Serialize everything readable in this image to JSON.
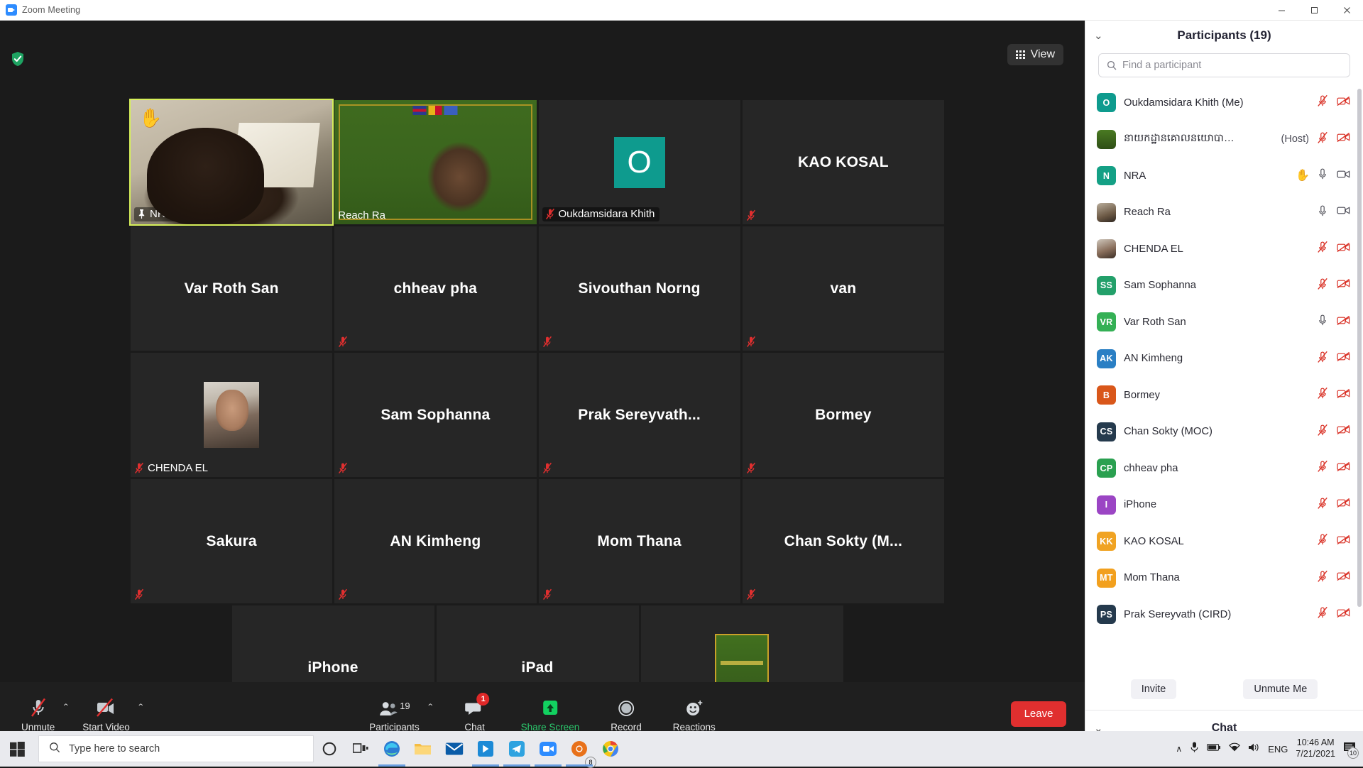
{
  "window": {
    "title": "Zoom Meeting",
    "app_icon": "zoom-icon",
    "minimize": "—",
    "maximize": "☐",
    "close": "✕"
  },
  "meeting": {
    "view_button": "View",
    "view_icon": "grid-icon",
    "security_icon": "shield-check-icon",
    "tiles": [
      [
        {
          "name": "NRA",
          "display": "corner",
          "video": true,
          "muted": false,
          "pinned": true,
          "active_speaker": true,
          "hand_raised": true,
          "photo": "nra"
        },
        {
          "name": "Reach Ra",
          "display": "corner",
          "video": true,
          "muted": false,
          "pinned": false,
          "active_speaker": false,
          "hand_raised": false,
          "photo": "reach"
        },
        {
          "name": "Oukdamsidara Khith",
          "display": "corner",
          "video": false,
          "muted": true,
          "avatar_initial": "O",
          "avatar_color": "#0e9b8e"
        },
        {
          "name": "KAO KOSAL",
          "display": "center",
          "video": false,
          "muted": true
        }
      ],
      [
        {
          "name": "Var Roth San",
          "display": "center",
          "video": false,
          "muted": false
        },
        {
          "name": "chheav pha",
          "display": "center",
          "video": false,
          "muted": true
        },
        {
          "name": "Sivouthan Norng",
          "display": "center",
          "video": false,
          "muted": true
        },
        {
          "name": "van",
          "display": "center",
          "video": false,
          "muted": true
        }
      ],
      [
        {
          "name": "CHENDA EL",
          "display": "corner",
          "video": false,
          "muted": true,
          "photo": "chenda"
        },
        {
          "name": "Sam Sophanna",
          "display": "center",
          "video": false,
          "muted": true
        },
        {
          "name": "Prak  Sereyvath...",
          "display": "center",
          "video": false,
          "muted": true
        },
        {
          "name": "Bormey",
          "display": "center",
          "video": false,
          "muted": true
        }
      ],
      [
        {
          "name": "Sakura",
          "display": "center",
          "video": false,
          "muted": true
        },
        {
          "name": "AN Kimheng",
          "display": "center",
          "video": false,
          "muted": true
        },
        {
          "name": "Mom Thana",
          "display": "center",
          "video": false,
          "muted": true
        },
        {
          "name": "Chan Sokty (M...",
          "display": "center",
          "video": false,
          "muted": true
        }
      ],
      [
        {
          "name": "iPhone",
          "display": "center",
          "video": false,
          "muted": true
        },
        {
          "name": "iPad",
          "display": "center",
          "video": false,
          "muted": false
        },
        {
          "name": "នាយកដ្ឋានគោលនយោ...",
          "display": "corner",
          "video": false,
          "muted": true,
          "photo": "khmer"
        }
      ]
    ]
  },
  "toolbar": {
    "mute": {
      "label": "Unmute",
      "icon": "mic-off-icon",
      "caret": "⌃"
    },
    "video": {
      "label": "Start Video",
      "icon": "video-off-icon",
      "caret": "⌃"
    },
    "participants": {
      "label": "Participants",
      "icon": "participants-icon",
      "count": "19",
      "caret": "⌃"
    },
    "chat": {
      "label": "Chat",
      "icon": "chat-icon",
      "badge": "1"
    },
    "share": {
      "label": "Share Screen",
      "icon": "share-screen-icon"
    },
    "record": {
      "label": "Record",
      "icon": "record-icon"
    },
    "reactions": {
      "label": "Reactions",
      "icon": "reactions-icon"
    },
    "leave": {
      "label": "Leave"
    }
  },
  "panel": {
    "title": "Participants (19)",
    "collapse_icon": "chevron-down-icon",
    "search": {
      "placeholder": "Find a participant",
      "value": "",
      "icon": "search-icon"
    },
    "participants": [
      {
        "name": "Oukdamsidara Khith (Me)",
        "initials": "O",
        "color": "#0e9b8e",
        "mic": "muted",
        "video": "off",
        "host": false,
        "hand": false
      },
      {
        "name": "នាយកដ្ឋានគោលនយោបា…",
        "initials": "",
        "color": "#4a7a22",
        "mic": "muted",
        "video": "off",
        "host": true,
        "host_label": "(Host)",
        "hand": false,
        "avatar_type": "image-khmer"
      },
      {
        "name": "NRA",
        "initials": "N",
        "color": "#14a085",
        "mic": "unmuted",
        "video": "on",
        "host": false,
        "hand": true
      },
      {
        "name": "Reach Ra",
        "initials": "",
        "color": "#8a7158",
        "mic": "unmuted",
        "video": "on",
        "host": false,
        "hand": false,
        "avatar_type": "photo1"
      },
      {
        "name": "CHENDA EL",
        "initials": "",
        "color": "#8a7158",
        "mic": "muted",
        "video": "off",
        "host": false,
        "hand": false,
        "avatar_type": "photo2"
      },
      {
        "name": "Sam Sophanna",
        "initials": "SS",
        "color": "#23a06a",
        "mic": "muted",
        "video": "off",
        "host": false,
        "hand": false
      },
      {
        "name": "Var Roth San",
        "initials": "VR",
        "color": "#34b055",
        "mic": "unmuted",
        "video": "off",
        "host": false,
        "hand": false
      },
      {
        "name": "AN Kimheng",
        "initials": "AK",
        "color": "#2a7fc4",
        "mic": "muted",
        "video": "off",
        "host": false,
        "hand": false
      },
      {
        "name": "Bormey",
        "initials": "B",
        "color": "#d9571a",
        "mic": "muted",
        "video": "off",
        "host": false,
        "hand": false
      },
      {
        "name": "Chan Sokty (MOC)",
        "initials": "CS",
        "color": "#253a4d",
        "mic": "muted",
        "video": "off",
        "host": false,
        "hand": false
      },
      {
        "name": "chheav pha",
        "initials": "CP",
        "color": "#2aa050",
        "mic": "muted",
        "video": "off",
        "host": false,
        "hand": false
      },
      {
        "name": "iPhone",
        "initials": "I",
        "color": "#9b45c4",
        "mic": "muted",
        "video": "off",
        "host": false,
        "hand": false
      },
      {
        "name": "KAO KOSAL",
        "initials": "KK",
        "color": "#f0a323",
        "mic": "muted",
        "video": "off",
        "host": false,
        "hand": false
      },
      {
        "name": "Mom Thana",
        "initials": "MT",
        "color": "#f2a01e",
        "mic": "muted",
        "video": "off",
        "host": false,
        "hand": false
      },
      {
        "name": "Prak Sereyvath (CIRD)",
        "initials": "PS",
        "color": "#253a4d",
        "mic": "muted",
        "video": "off",
        "host": false,
        "hand": false
      }
    ],
    "invite_button": "Invite",
    "unmute_me_button": "Unmute Me",
    "chat_section": {
      "title": "Chat",
      "collapse_icon": "chevron-down-icon"
    }
  },
  "taskbar": {
    "start_icon": "windows-start-icon",
    "search": {
      "placeholder": "Type here to search",
      "icon": "search-icon"
    },
    "items": [
      {
        "icon": "cortana-icon",
        "name": "cortana"
      },
      {
        "icon": "task-view-icon",
        "name": "task-view"
      },
      {
        "icon": "edge-icon",
        "name": "microsoft-edge"
      },
      {
        "icon": "file-explorer-icon",
        "name": "file-explorer"
      },
      {
        "icon": "mail-icon",
        "name": "mail"
      },
      {
        "icon": "store-icon",
        "name": "microsoft-store"
      },
      {
        "icon": "telegram-icon",
        "name": "telegram"
      },
      {
        "icon": "zoom-icon",
        "name": "zoom"
      },
      {
        "icon": "chrome-beta-icon",
        "name": "chrome-beta"
      },
      {
        "icon": "chrome-icon",
        "name": "google-chrome"
      }
    ],
    "tray": {
      "chevron": "∧",
      "mic_icon": "microphone-icon",
      "battery_icon": "battery-icon",
      "network_icon": "network-icon",
      "volume_icon": "volume-icon",
      "language": "ENG",
      "time": "10:46 AM",
      "date": "7/21/2021",
      "notifications_icon": "notifications-icon",
      "notifications_count": "10"
    }
  }
}
